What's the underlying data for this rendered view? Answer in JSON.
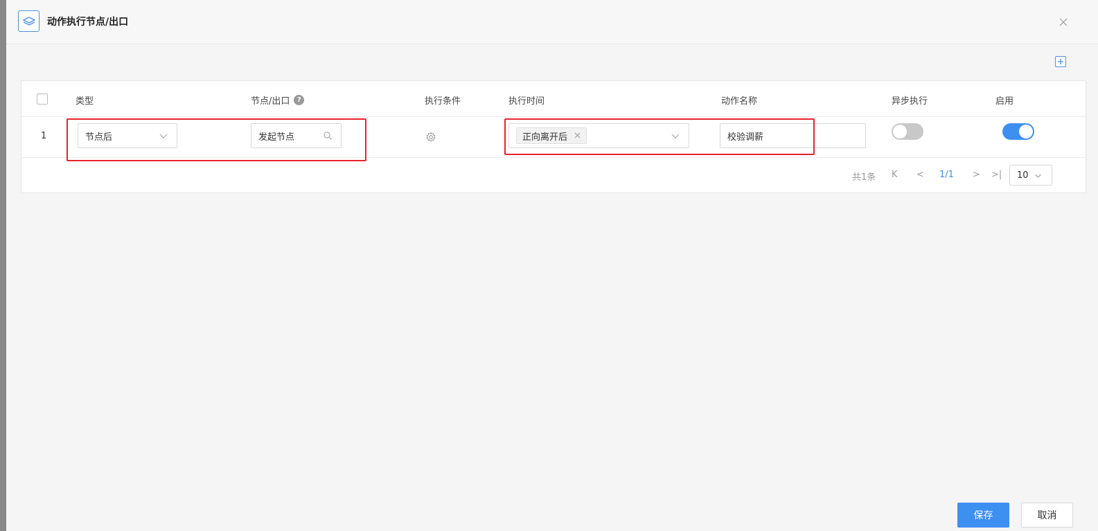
{
  "dialog": {
    "title": "动作执行节点/出口"
  },
  "table": {
    "columns": {
      "type": "类型",
      "node_exit": "节点/出口",
      "condition": "执行条件",
      "exec_time": "执行时间",
      "action_name": "动作名称",
      "async": "异步执行",
      "enabled": "启用"
    },
    "help_glyph": "?",
    "rows": [
      {
        "index": "1",
        "type": "节点后",
        "node": "发起节点",
        "exec_time_tag": "正向离开后",
        "action_name": "校验调薪",
        "async": false,
        "enabled": true
      }
    ]
  },
  "pagination": {
    "total": "共1条",
    "first": "K",
    "prev": "<",
    "current": "1/1",
    "next": ">",
    "last": ">|",
    "page_size": "10"
  },
  "footer": {
    "save_label": "保存",
    "cancel_label": "取消"
  },
  "colors": {
    "accent": "#3d8ff0",
    "highlight": "#e8232b"
  },
  "icons": [
    "layers-icon",
    "close-icon",
    "add-icon",
    "help-icon",
    "chevron-down-icon",
    "search-icon",
    "gear-icon",
    "tag-close-icon"
  ]
}
